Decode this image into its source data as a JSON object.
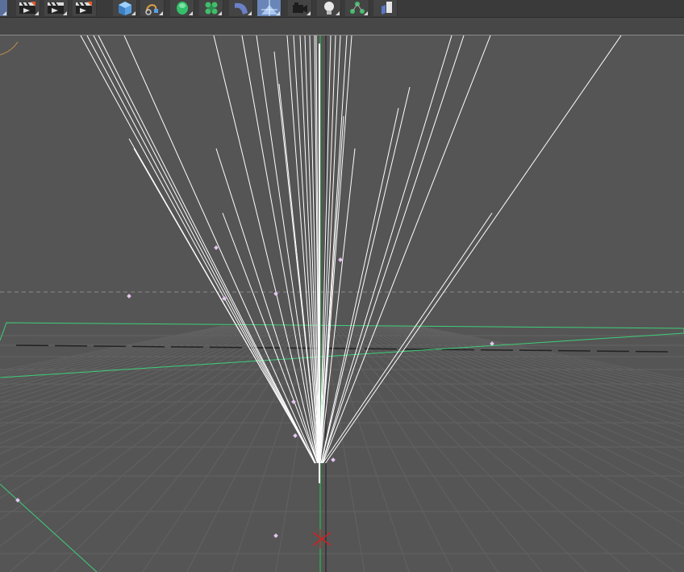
{
  "toolbar": {
    "tools": [
      {
        "name": "render-active-view-icon"
      },
      {
        "name": "render-to-picture-viewer-icon"
      },
      {
        "name": "render-settings-icon"
      },
      {
        "name": "cube-primitive-icon"
      },
      {
        "name": "spline-pen-icon"
      },
      {
        "name": "subdivision-surface-icon"
      },
      {
        "name": "cloner-icon"
      },
      {
        "name": "bend-deformer-icon"
      },
      {
        "name": "floor-icon"
      },
      {
        "name": "camera-icon"
      },
      {
        "name": "light-icon"
      },
      {
        "name": "tag-icon"
      },
      {
        "name": "effector-icon"
      }
    ]
  },
  "colors": {
    "viewport_bg": "#555555",
    "grid": "#626262",
    "strands": "#ffffff",
    "selection_outline": "#3ecf7a",
    "axis_green": "#2fa84f",
    "axis_red": "#d02020",
    "points": "#e6c6f2"
  }
}
